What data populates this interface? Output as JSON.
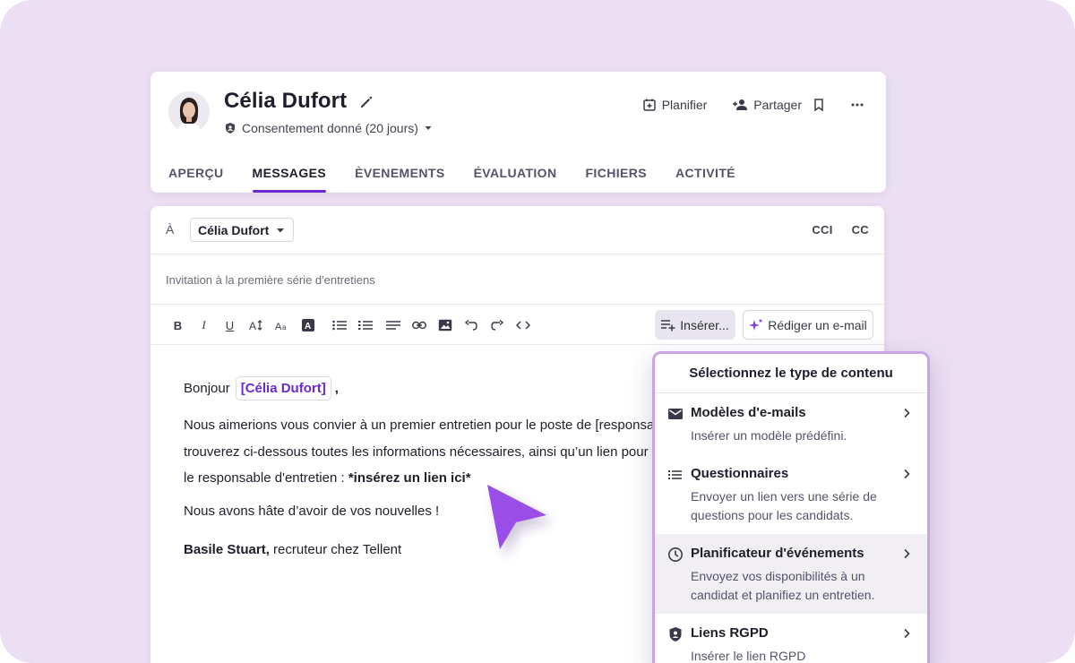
{
  "candidate": {
    "name": "Célia Dufort",
    "consent": "Consentement donné (20 jours)"
  },
  "header_actions": {
    "schedule": "Planifier",
    "share": "Partager"
  },
  "tabs": [
    {
      "label": "APERÇU",
      "active": false
    },
    {
      "label": "MESSAGES",
      "active": true
    },
    {
      "label": "ÈVENEMENTS",
      "active": false
    },
    {
      "label": "ÉVALUATION",
      "active": false
    },
    {
      "label": "FICHIERS",
      "active": false
    },
    {
      "label": "ACTIVITÉ",
      "active": false
    }
  ],
  "compose": {
    "to_label": "À",
    "recipient": "Célia Dufort",
    "bcc": "CCI",
    "cc": "CC",
    "subject": "Invitation à la première série d'entretiens",
    "insert_label": "Insérer...",
    "write_email_label": "Rédiger un e-mail",
    "toolbar_icons": [
      "bold-icon",
      "italic-icon",
      "underline-icon",
      "text-size-icon",
      "font-case-icon",
      "text-color-icon",
      "bullet-list-icon",
      "numbered-list-icon",
      "align-icon",
      "link-icon",
      "image-icon",
      "undo-icon",
      "redo-icon",
      "code-icon"
    ]
  },
  "email_body": {
    "greeting": "Bonjour",
    "name_chip": "[Célia Dufort]",
    "comma": ",",
    "line1": "Nous aimerions vous convier à un premier entretien pour le poste de [responsable",
    "line2": "trouverez ci-dessous toutes les informations nécessaires, ainsi qu’un lien pour",
    "line3_prefix": "le responsable d'entretien : ",
    "line3_bold": "*insérez un lien ici*",
    "closing": "Nous avons hâte d’avoir de vos nouvelles !",
    "signature_name": "Basile Stuart,",
    "signature_rest": " recruteur chez Tellent"
  },
  "dropdown": {
    "title": "Sélectionnez le type de contenu",
    "items": [
      {
        "name": "Modèles d'e-mails",
        "desc": "Insérer un modèle prédéfini.",
        "icon": "mail-icon",
        "highlighted": false
      },
      {
        "name": "Questionnaires",
        "desc": "Envoyer un lien vers une série de questions pour les candidats.",
        "icon": "list-icon",
        "highlighted": false
      },
      {
        "name": "Planificateur d'événements",
        "desc": "Envoyez vos disponibilités à un candidat et planifiez un entretien.",
        "icon": "clock-icon",
        "highlighted": true
      },
      {
        "name": "Liens RGPD",
        "desc": "Insérer le lien RGPD",
        "icon": "shield-icon",
        "highlighted": false
      }
    ]
  },
  "colors": {
    "background": "#ecdff3",
    "accent": "#6a2ad0",
    "cursor": "#9b4ee8",
    "dropdown_border": "#c9a3e3"
  }
}
